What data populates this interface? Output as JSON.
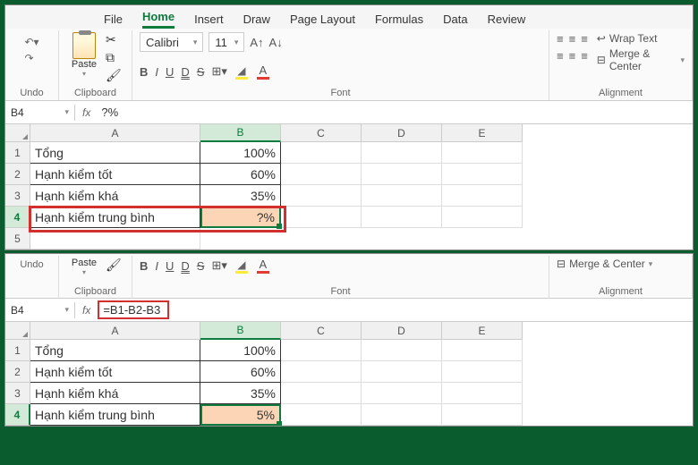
{
  "menu": {
    "file": "File",
    "home": "Home",
    "insert": "Insert",
    "draw": "Draw",
    "pageLayout": "Page Layout",
    "formulas": "Formulas",
    "data": "Data",
    "review": "Review"
  },
  "ribbon": {
    "undo": "Undo",
    "paste": "Paste",
    "clipboard": "Clipboard",
    "fontName": "Calibri",
    "fontSize": "11",
    "bigA": "A^",
    "smallA": "A˅",
    "bold": "B",
    "italic": "I",
    "underline": "U",
    "double": "D",
    "strike": "S",
    "fontGroup": "Font",
    "wrapText": "Wrap Text",
    "mergeCenter": "Merge & Center",
    "alignment": "Alignment"
  },
  "top": {
    "nameBox": "B4",
    "fx": "fx",
    "formula": "?%",
    "cols": [
      "A",
      "B",
      "C",
      "D",
      "E"
    ],
    "rows": [
      {
        "n": "1",
        "a": "Tổng",
        "b": "100%"
      },
      {
        "n": "2",
        "a": "Hạnh kiểm tốt",
        "b": "60%"
      },
      {
        "n": "3",
        "a": "Hạnh kiểm khá",
        "b": "35%"
      },
      {
        "n": "4",
        "a": "Hạnh kiểm trung bình",
        "b": "?%"
      }
    ],
    "row5": "5"
  },
  "bottom": {
    "nameBox": "B4",
    "fx": "fx",
    "formula": "=B1-B2-B3",
    "cols": [
      "A",
      "B",
      "C",
      "D",
      "E"
    ],
    "rows": [
      {
        "n": "1",
        "a": "Tổng",
        "b": "100%"
      },
      {
        "n": "2",
        "a": "Hạnh kiểm tốt",
        "b": "60%"
      },
      {
        "n": "3",
        "a": "Hạnh kiểm khá",
        "b": "35%"
      },
      {
        "n": "4",
        "a": "Hạnh kiểm trung bình",
        "b": "5%"
      }
    ]
  }
}
